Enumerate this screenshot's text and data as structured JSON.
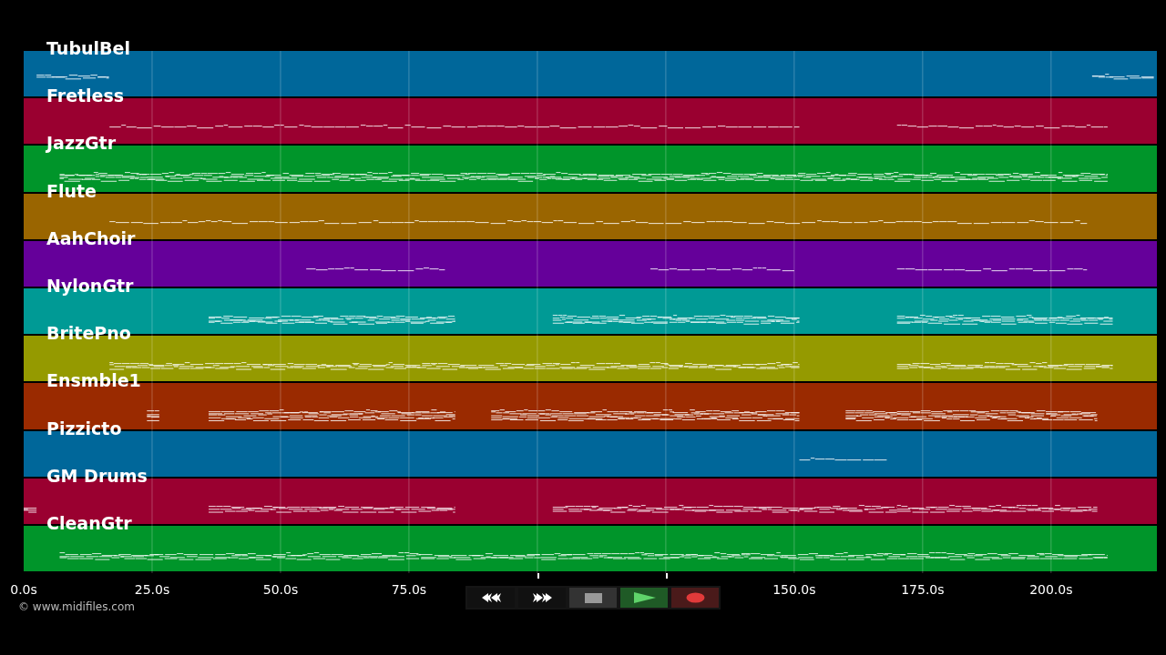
{
  "tracks": [
    {
      "name": "TubulBel",
      "color": "#00679a"
    },
    {
      "name": "Fretless",
      "color": "#9a0030"
    },
    {
      "name": "JazzGtr",
      "color": "#00952a"
    },
    {
      "name": "Flute",
      "color": "#9a6500"
    },
    {
      "name": "AahChoir",
      "color": "#65009a"
    },
    {
      "name": "NylonGtr",
      "color": "#009a95"
    },
    {
      "name": "BritePno",
      "color": "#959a00"
    },
    {
      "name": "Ensmble1",
      "color": "#9a2a00"
    },
    {
      "name": "Pizzicto",
      "color": "#00679a"
    },
    {
      "name": "GM Drums",
      "color": "#9a0030"
    },
    {
      "name": "CleanGtr",
      "color": "#00952a"
    }
  ],
  "time_axis": [
    {
      "label": "0.0s",
      "covered": false
    },
    {
      "label": "25.0s",
      "covered": false
    },
    {
      "label": "50.0s",
      "covered": false
    },
    {
      "label": "75.0s",
      "covered": false
    },
    {
      "covered": true
    },
    {
      "covered": true
    },
    {
      "label": "150.0s",
      "covered": false
    },
    {
      "label": "175.0s",
      "covered": false
    },
    {
      "label": "200.0s",
      "covered": false
    }
  ],
  "credit": "© www.midifiles.com",
  "controls": [
    {
      "kind": "rewind"
    },
    {
      "kind": "fast_forward"
    },
    {
      "kind": "stop"
    },
    {
      "kind": "play"
    },
    {
      "kind": "record"
    }
  ]
}
